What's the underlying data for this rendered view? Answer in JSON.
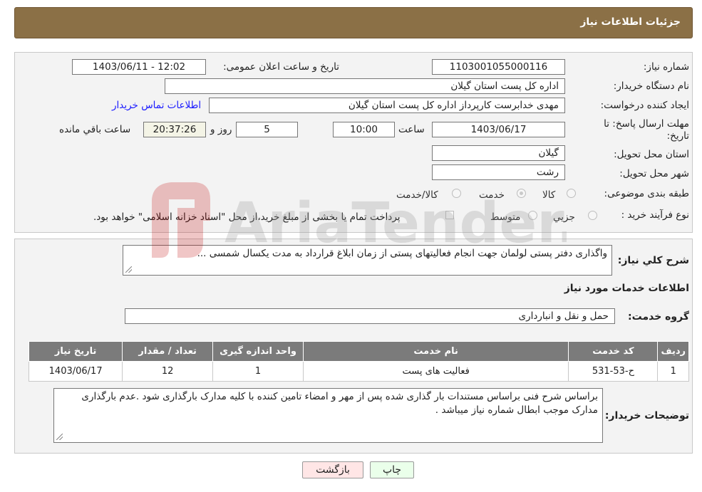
{
  "header": {
    "title": "جزئیات اطلاعات نیاز"
  },
  "form": {
    "need_number_label": "شماره نیاز:",
    "need_number": "1103001055000116",
    "announce_label": "تاریخ و ساعت اعلان عمومی:",
    "announce_value": "1403/06/11 - 12:02",
    "buyer_org_label": "نام دستگاه خریدار:",
    "buyer_org": "اداره کل پست استان گیلان",
    "creator_label": "ایجاد کننده درخواست:",
    "creator": "مهدی  خدابرست  کارپرداز  اداره کل پست استان گیلان",
    "contact_link": "اطلاعات تماس خریدار",
    "deadline_label_1": "مهلت ارسال پاسخ: تا",
    "deadline_label_2": "تاریخ:",
    "deadline_date": "1403/06/17",
    "time_label": "ساعت",
    "deadline_time": "10:00",
    "days_value": "5",
    "days_label": "روز و",
    "remaining_time": "20:37:26",
    "remaining_label": "ساعت باقي مانده",
    "province_label": "استان محل تحویل:",
    "province": "گیلان",
    "city_label": "شهر محل تحویل:",
    "city": "رشت",
    "category_label": "طبقه بندی موضوعی:",
    "category_options": [
      "کالا",
      "خدمت",
      "کالا/خدمت"
    ],
    "category_selected": "خدمت",
    "process_label": "نوع فرآیند خرید :",
    "process_options": [
      "جزیي",
      "متوسط"
    ],
    "payment_note": "پرداخت تمام یا بخشی از مبلغ خرید،از محل \"اسناد خزانه اسلامی\" خواهد بود."
  },
  "summary": {
    "label": "شرح کلي نياز:",
    "value": "واگذاری دفتر پستی لولمان جهت انجام فعالیتهای پستی از زمان ابلاغ قرارداد به مدت یکسال شمسی ..."
  },
  "services": {
    "section_title": "اطلاعات خدمات مورد نياز",
    "group_label": "گروه خدمت:",
    "group_value": "حمل و نقل و انبارداری",
    "columns": [
      "ردیف",
      "کد خدمت",
      "نام خدمت",
      "واحد اندازه گیری",
      "تعداد / مقدار",
      "تاریخ نیاز"
    ],
    "rows": [
      [
        "1",
        "ح-53-531",
        "فعالیت های پست",
        "1",
        "12",
        "1403/06/17"
      ]
    ]
  },
  "buyer_notes": {
    "label": "توضیحات خریدار:",
    "value": "براساس شرح فنی براساس مستندات بار گذاری شده پس از مهر و امضاء تامین کننده با کلیه مدارک بارگذاری شود .عدم بارگذاری مدارک موجب ابطال شماره نیاز میباشد ."
  },
  "buttons": {
    "print": "چاپ",
    "back": "بازگشت"
  },
  "watermark": {
    "text": "AriaTender.neT"
  },
  "colors": {
    "header_bg": "#8b7046",
    "table_header_bg": "#7b7b7b",
    "back_btn_bg": "#ffe6e6",
    "print_btn_bg": "#eaffea"
  }
}
